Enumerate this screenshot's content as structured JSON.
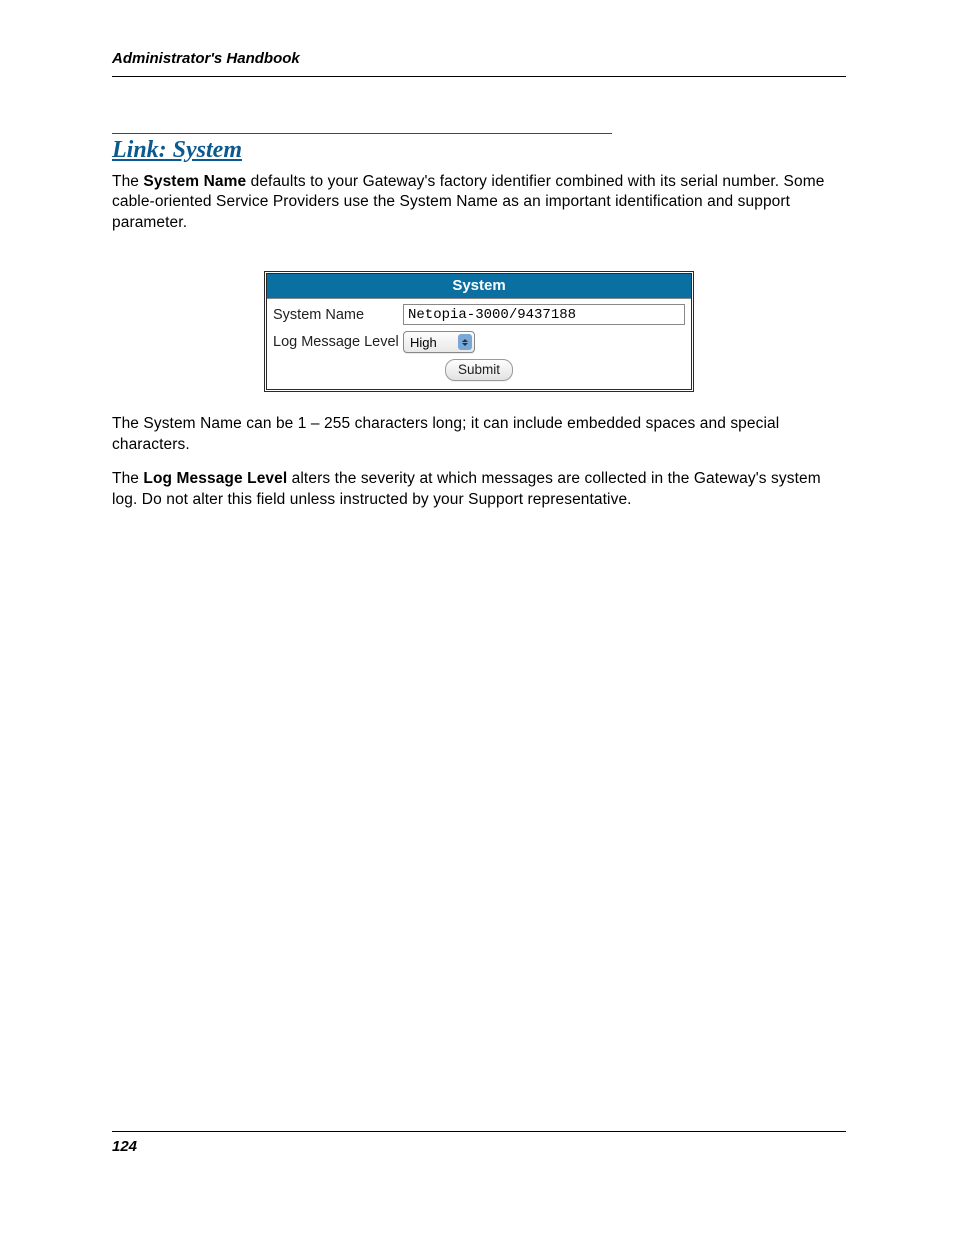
{
  "header": {
    "title": "Administrator's Handbook"
  },
  "section": {
    "heading": "Link: System"
  },
  "paragraphs": {
    "p1_pre": "The ",
    "p1_bold": "System Name",
    "p1_post": " defaults to your Gateway's factory identifier combined with its serial number. Some cable-oriented Service Providers use the System Name as an important identification and support parameter.",
    "p2": "The System Name can be 1 – 255 characters long; it can include embedded spaces and special characters.",
    "p3_pre": "The ",
    "p3_bold": "Log Message Level",
    "p3_post": " alters the severity at which messages are collected in the Gateway's system log. Do not alter this field unless instructed by your Support representative."
  },
  "panel": {
    "title": "System",
    "rows": {
      "system_name": {
        "label": "System Name",
        "value": "Netopia-3000/9437188"
      },
      "log_level": {
        "label": "Log Message Level",
        "value": "High"
      }
    },
    "submit_label": "Submit"
  },
  "footer": {
    "page_number": "124"
  }
}
